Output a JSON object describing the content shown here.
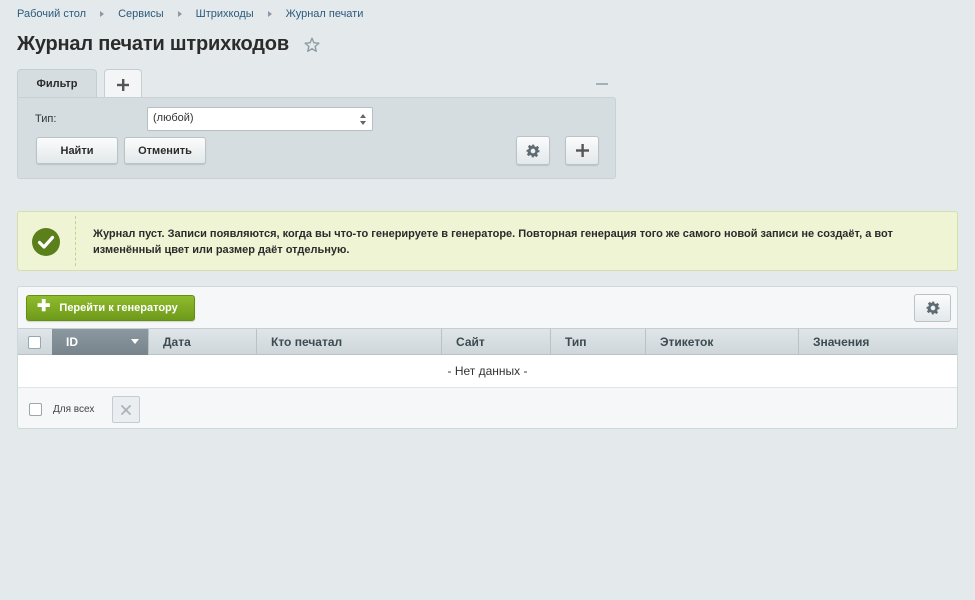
{
  "breadcrumbs": [
    "Рабочий стол",
    "Сервисы",
    "Штрихкоды",
    "Журнал печати"
  ],
  "page_title": "Журнал печати штрихкодов",
  "icons": {
    "favorite": "star-icon",
    "settings": "gear-icon",
    "add": "plus-icon",
    "success": "check-circle-icon",
    "delete": "close-icon"
  },
  "filter": {
    "tab_label": "Фильтр",
    "type_label": "Тип:",
    "type_value": "(любой)",
    "find_label": "Найти",
    "cancel_label": "Отменить"
  },
  "notice": {
    "text": "Журнал пуст. Записи появляются, когда вы что-то генерируете в генераторе. Повторная генерация того же самого новой записи не создаёт, а вот изменённый цвет или размер даёт отдельную."
  },
  "grid": {
    "generator_button": "Перейти к генератору",
    "columns": [
      "ID",
      "Дата",
      "Кто печатал",
      "Сайт",
      "Тип",
      "Этикеток",
      "Значения"
    ],
    "sorted_column": "ID",
    "empty_text": "- Нет данных -",
    "for_all_label": "Для всех"
  },
  "colors": {
    "background": "#e4e9ec",
    "link": "#2b5b7c",
    "accent_green": "#7aa622",
    "notice_background": "#eef4d4",
    "success_icon": "#5b7f1a"
  }
}
